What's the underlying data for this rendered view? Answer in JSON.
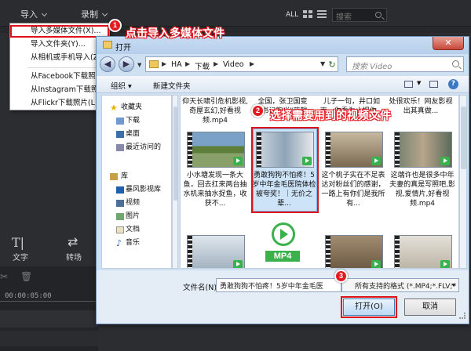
{
  "editor": {
    "menu_import": "导入",
    "menu_record": "录制",
    "view_all": "ALL",
    "search_placeholder": "搜索",
    "tool_text": "文字",
    "tool_transition": "转场",
    "timecode": "00:00:05:00"
  },
  "import_menu": {
    "items": [
      "导入多媒体文件(X)...",
      "导入文件夹(Y)...",
      "从相机或手机导入(Z)...",
      "从Facebook下载照片",
      "从Instagram下载照片",
      "从Flickr下载照片(L)"
    ]
  },
  "annotations": {
    "step1_num": "1",
    "step1_text": "点击导入多媒体文件",
    "step2_num": "2",
    "step2_text": "选择需要用到的视频文件",
    "step3_num": "3"
  },
  "dialog": {
    "title": "打开",
    "close": "✕",
    "breadcrumb": [
      "HA",
      "下载",
      "Video"
    ],
    "search_placeholder": "搜索 Video",
    "organize": "组织",
    "new_folder": "新建文件夹",
    "nav": [
      {
        "label": "收藏夹",
        "icon": "star-icon"
      },
      {
        "label": "下载",
        "icon": "download-folder-icon"
      },
      {
        "label": "桌面",
        "icon": "desktop-icon"
      },
      {
        "label": "最近访问的",
        "icon": "recent-icon"
      },
      {
        "label": "库",
        "icon": "library-icon"
      },
      {
        "label": "暴风影视库",
        "icon": "video-library-icon"
      },
      {
        "label": "视频",
        "icon": "video-icon"
      },
      {
        "label": "图片",
        "icon": "picture-icon"
      },
      {
        "label": "文档",
        "icon": "document-icon"
      },
      {
        "label": "音乐",
        "icon": "music-icon"
      }
    ],
    "file_row0": [
      "仰天长啸引危机影视,奇屋玄幻,好看视频.mp4",
      "全国，张卫国变乡\"书记鲍光\"孩就...",
      "儿子一句，井口如雨，你看为止把你...",
      "处很欢乐！网友影视出其真做..."
    ],
    "file_row1": [
      "小水塘发现一条大鱼，回去扛来两台抽水机来抽水捉鱼，收获不...",
      "勇敢狗狗不怕疼！5岁中年金毛医院体检被夸奖！｜无价之辈...",
      "这个桃子实在不足表达对粉丝们的感谢，一路上有你们是我所有...",
      "这端许也是很多中年夫妻的真是写照吧,影视,爱情片,好看视频.mp4"
    ],
    "mp4_label": "MP4",
    "filename_label": "文件名(N):",
    "filename_value": "勇敢狗狗不怕疼！5岁中年金毛医",
    "filetype_value": "所有支持的格式 (*.MP4;*.FLV;*",
    "open_button": "打开(O)",
    "cancel_button": "取消"
  },
  "colors": {
    "accent_red": "#e21b22",
    "dialog_blue": "#cfe0f2",
    "editor_bg": "#2b2d31"
  }
}
